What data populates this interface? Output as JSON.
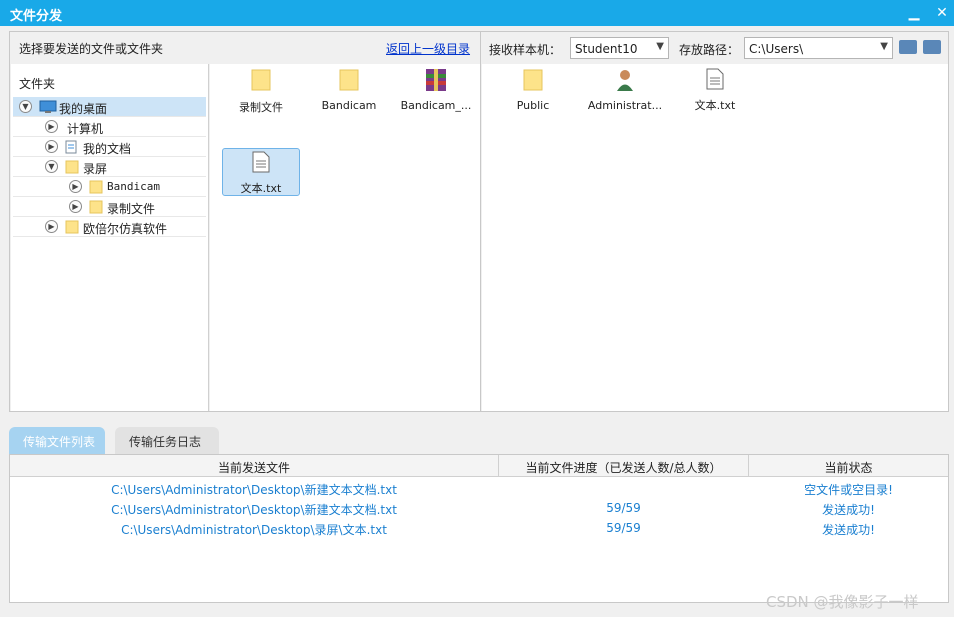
{
  "window": {
    "title": "文件分发"
  },
  "left": {
    "header": "选择要发送的文件或文件夹",
    "up_link": "返回上一级目录",
    "folder_label": "文件夹",
    "tree": [
      {
        "label": "我的桌面",
        "icon": "desktop-icon",
        "expanded": true
      },
      {
        "label": "计算机",
        "icon": "computer-icon",
        "expanded": false
      },
      {
        "label": "我的文档",
        "icon": "document-icon",
        "expanded": false
      },
      {
        "label": "录屏",
        "icon": "folder-icon",
        "expanded": true
      },
      {
        "label": "Bandicam",
        "icon": "folder-icon",
        "expanded": false
      },
      {
        "label": "录制文件",
        "icon": "folder-icon",
        "expanded": false
      },
      {
        "label": "欧倍尔仿真软件",
        "icon": "folder-icon",
        "expanded": false
      }
    ],
    "files": [
      {
        "label": "录制文件",
        "icon": "folder-icon"
      },
      {
        "label": "Bandicam",
        "icon": "folder-icon"
      },
      {
        "label": "Bandicam_...",
        "icon": "archive-icon"
      },
      {
        "label": "文本.txt",
        "icon": "text-file-icon"
      }
    ]
  },
  "right": {
    "receiver_label": "接收样本机：",
    "receiver_value": "Student10",
    "path_label": "存放路径：",
    "path_value": "C:\\Users\\",
    "files": [
      {
        "label": "Public",
        "icon": "folder-icon"
      },
      {
        "label": "Administrat...",
        "icon": "user-icon"
      },
      {
        "label": "文本.txt",
        "icon": "text-file-icon"
      }
    ]
  },
  "tabs": [
    "传输文件列表",
    "传输任务日志"
  ],
  "table": {
    "headers": [
      "当前发送文件",
      "当前文件进度（已发送人数/总人数）",
      "当前状态"
    ],
    "rows": [
      {
        "file": "C:\\Users\\Administrator\\Desktop\\新建文本文档.txt",
        "progress": "",
        "status": "空文件或空目录!"
      },
      {
        "file": "C:\\Users\\Administrator\\Desktop\\新建文本文档.txt",
        "progress": "59/59",
        "status": "发送成功!"
      },
      {
        "file": "C:\\Users\\Administrator\\Desktop\\录屏\\文本.txt",
        "progress": "59/59",
        "status": "发送成功!"
      }
    ]
  },
  "watermark": "CSDN @我像影子一样",
  "colors": {
    "titlebar": "#19a9e8",
    "link": "#0033cc",
    "row_text": "#1a7fd0",
    "tab_active": "#a6d3f1"
  }
}
